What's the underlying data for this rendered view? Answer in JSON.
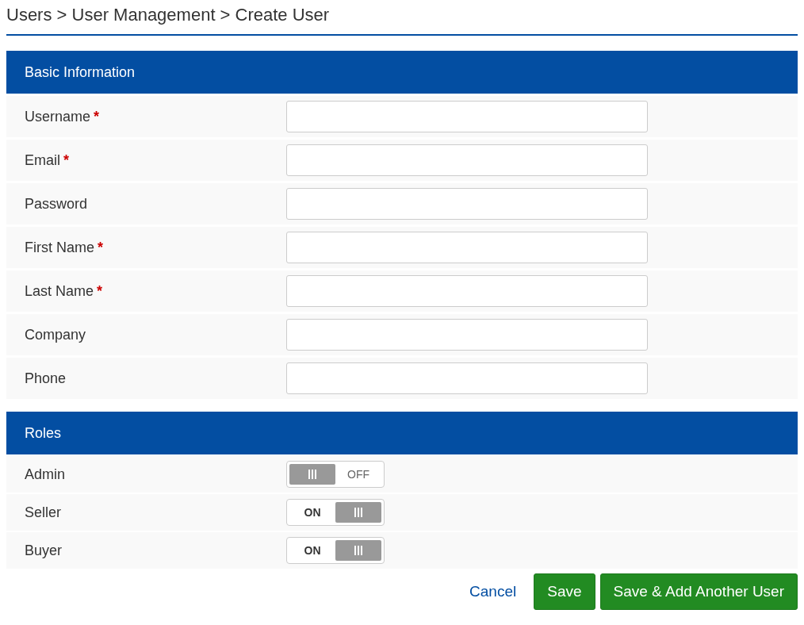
{
  "breadcrumb": "Users > User Management > Create User",
  "sections": [
    {
      "title": "Basic Information",
      "kind": "fields",
      "rows": [
        {
          "label": "Username",
          "required": true
        },
        {
          "label": "Email",
          "required": true
        },
        {
          "label": "Password",
          "required": false
        },
        {
          "label": "First Name",
          "required": true
        },
        {
          "label": "Last Name",
          "required": true
        },
        {
          "label": "Company",
          "required": false
        },
        {
          "label": "Phone",
          "required": false
        }
      ]
    },
    {
      "title": "Roles",
      "kind": "toggles",
      "rows": [
        {
          "label": "Admin",
          "on": false,
          "state_text": "OFF"
        },
        {
          "label": "Seller",
          "on": true,
          "state_text": "ON"
        },
        {
          "label": "Buyer",
          "on": true,
          "state_text": "ON"
        }
      ]
    }
  ],
  "actions": [
    {
      "kind": "link",
      "label": "Cancel"
    },
    {
      "kind": "button",
      "label": "Save"
    },
    {
      "kind": "button",
      "label": "Save & Add Another User"
    }
  ],
  "required_mark": "*"
}
